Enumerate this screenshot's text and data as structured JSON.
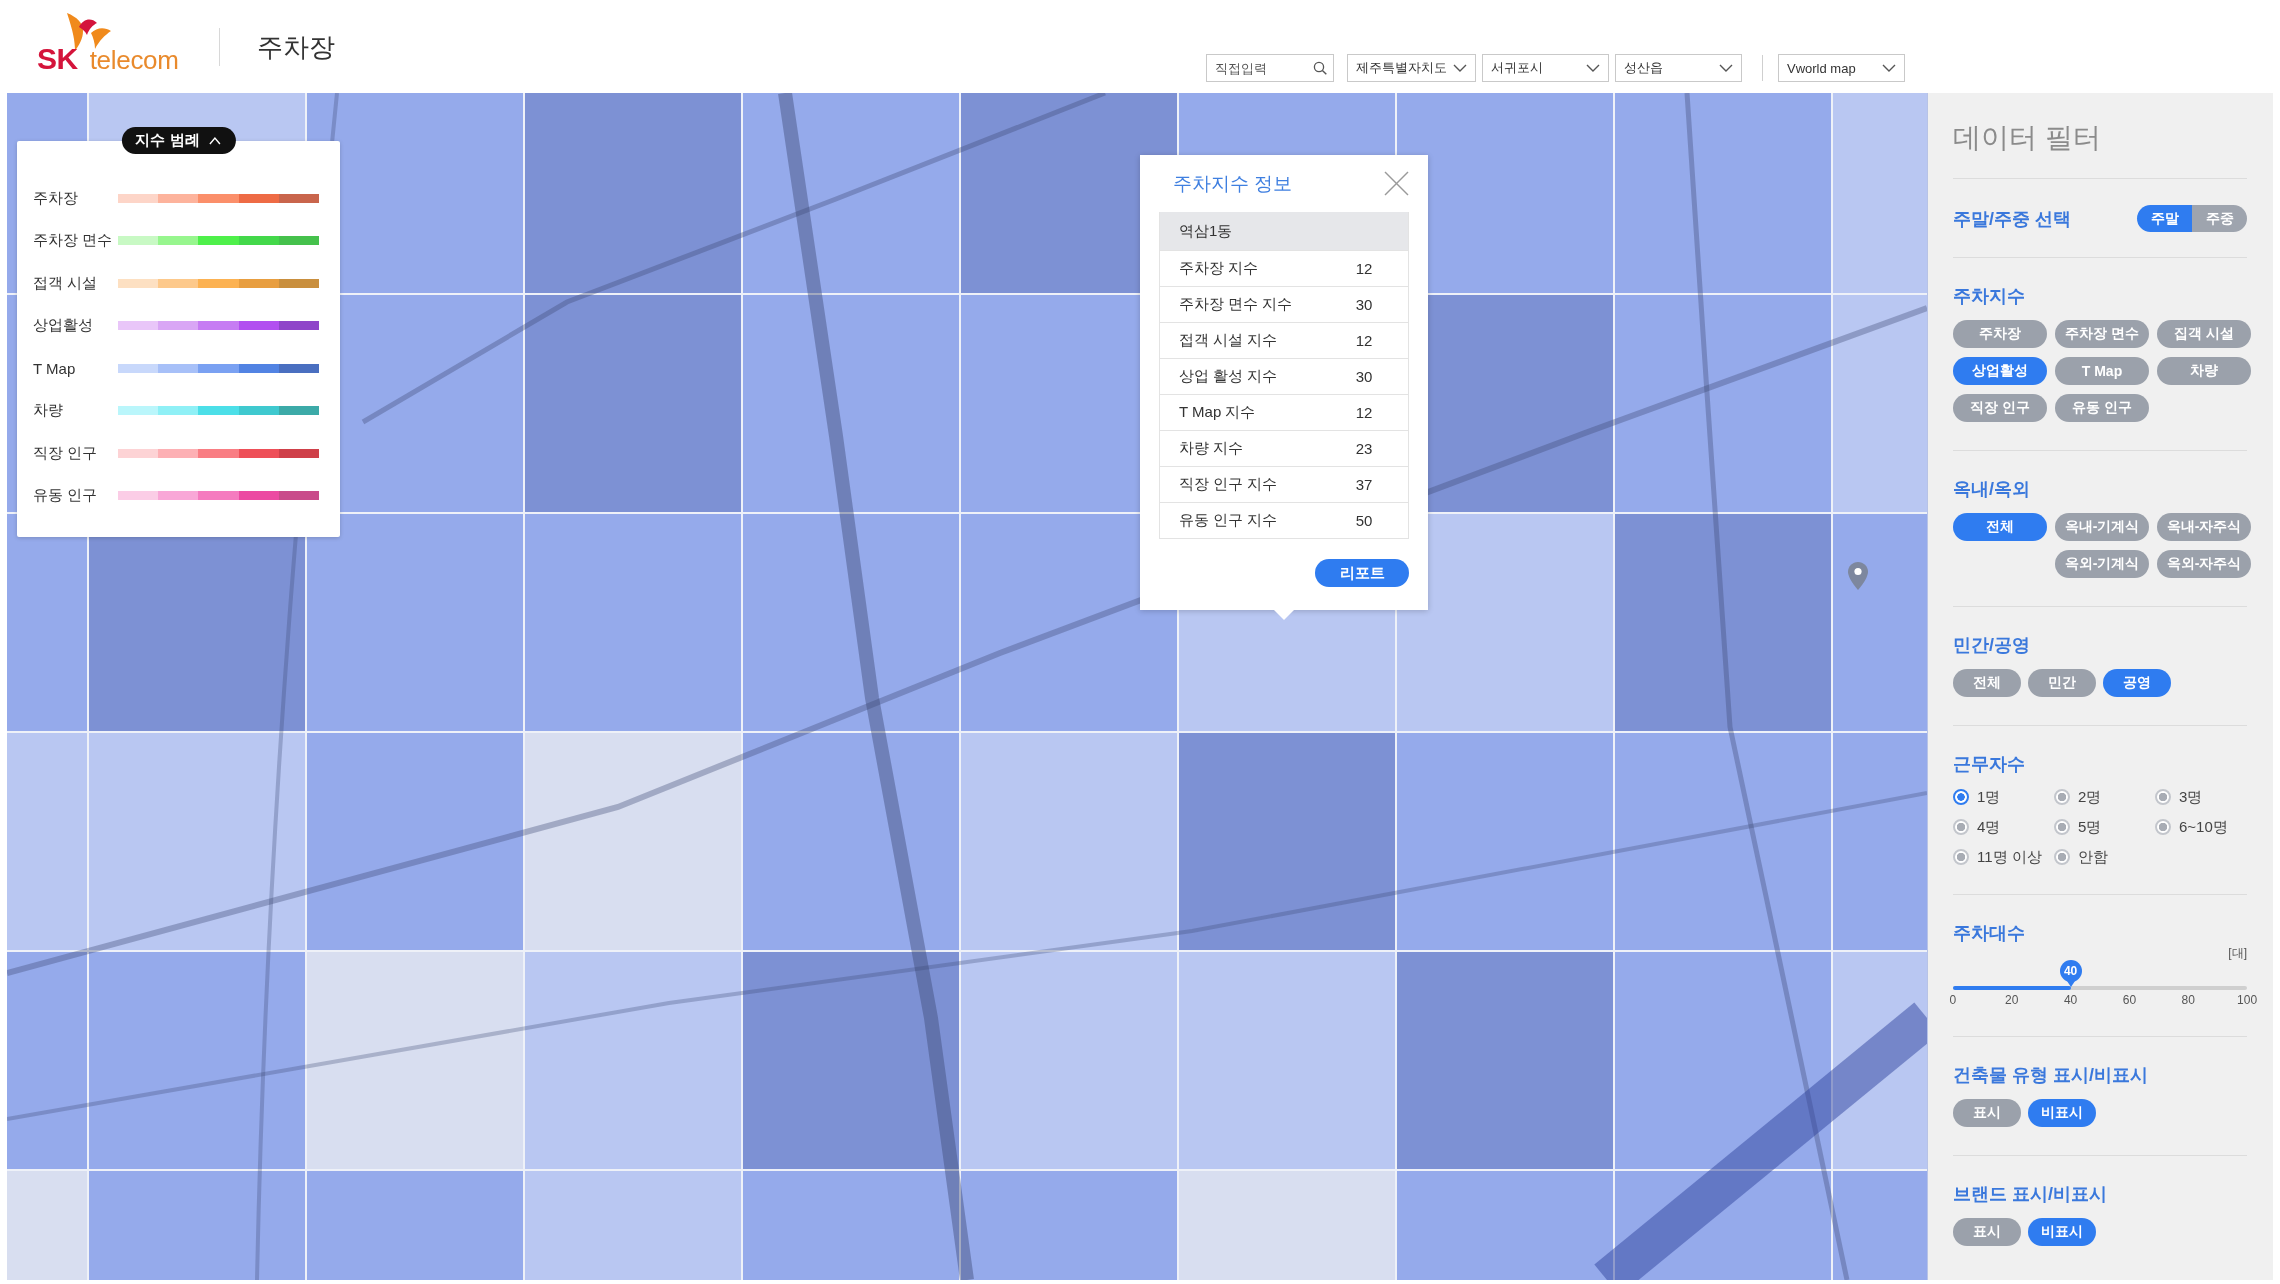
{
  "header": {
    "logo": {
      "mark": "SK",
      "name": "telecom"
    },
    "title": "주차장",
    "search": {
      "placeholder": "직접입력"
    },
    "selects": [
      {
        "value": "제주특별자치도"
      },
      {
        "value": "서귀포시"
      },
      {
        "value": "성산읍"
      }
    ],
    "map_select": {
      "value": "Vworld map"
    }
  },
  "map": {
    "grid": [
      {
        "cells": [
          {
            "color": "#95aaeb"
          },
          {
            "color": "#b9c7f2"
          },
          {
            "color": "#95aaeb"
          },
          {
            "color": "#7d91d4"
          },
          {
            "color": "#95aaeb"
          },
          {
            "color": "#7d91d4"
          },
          {
            "color": "#95aaeb"
          },
          {
            "color": "#95aaeb"
          },
          {
            "color": "#95aaeb"
          },
          {
            "color": "#b9c7f2"
          }
        ]
      },
      {
        "cells": [
          {
            "color": "#95aaeb"
          },
          null,
          {
            "color": "#95aaeb"
          },
          {
            "color": "#7d91d4"
          },
          {
            "color": "#95aaeb"
          },
          {
            "color": "#95aaeb"
          },
          null,
          {
            "color": "#7d91d4"
          },
          {
            "color": "#95aaeb"
          },
          {
            "color": "#b9c7f2"
          }
        ]
      },
      {
        "cells": [
          {
            "color": "#95aaeb"
          },
          {
            "color": "#7d91d4"
          },
          {
            "color": "#95aaeb"
          },
          {
            "color": "#95aaeb"
          },
          {
            "color": "#95aaeb"
          },
          {
            "color": "#95aaeb"
          },
          {
            "color": "#b9c7f2"
          },
          {
            "color": "#b9c7f2"
          },
          {
            "color": "#7d91d4"
          },
          {
            "color": "#95aaeb"
          }
        ]
      },
      {
        "cells": [
          {
            "color": "#b9c7f2"
          },
          {
            "color": "#b9c7f2"
          },
          {
            "color": "#95aaeb"
          },
          {
            "color": "#d8def0"
          },
          {
            "color": "#95aaeb"
          },
          {
            "color": "#b9c7f2"
          },
          {
            "color": "#7d91d4"
          },
          {
            "color": "#95aaeb"
          },
          {
            "color": "#95aaeb"
          },
          {
            "color": "#95aaeb"
          }
        ]
      },
      {
        "cells": [
          {
            "color": "#95aaeb"
          },
          {
            "color": "#95aaeb"
          },
          {
            "color": "#d8def0"
          },
          {
            "color": "#b9c7f2"
          },
          {
            "color": "#7d91d4"
          },
          {
            "color": "#b9c7f2"
          },
          {
            "color": "#b9c7f2"
          },
          {
            "color": "#7d91d4"
          },
          {
            "color": "#95aaeb"
          },
          {
            "color": "#b9c7f2"
          }
        ]
      },
      {
        "cells": [
          {
            "color": "#d8def0"
          },
          {
            "color": "#95aaeb"
          },
          {
            "color": "#95aaeb"
          },
          {
            "color": "#b9c7f2"
          },
          {
            "color": "#95aaeb"
          },
          {
            "color": "#95aaeb"
          },
          {
            "color": "#d8def0"
          },
          {
            "color": "#95aaeb"
          },
          {
            "color": "#95aaeb"
          },
          {
            "color": "#95aaeb"
          }
        ]
      }
    ],
    "legend": {
      "label": "지수 범례",
      "expanded": true,
      "items": [
        {
          "label": "주차장",
          "segments": [
            {
              "color": "#fdd5c8"
            },
            {
              "color": "#fdb39c"
            },
            {
              "color": "#fb8f6a"
            },
            {
              "color": "#ee6b45"
            },
            {
              "color": "#c9654c"
            }
          ]
        },
        {
          "label": "주차장 면수",
          "segments": [
            {
              "color": "#c8f9c4"
            },
            {
              "color": "#97f68e"
            },
            {
              "color": "#4ef04a"
            },
            {
              "color": "#43d84a"
            },
            {
              "color": "#45c14c"
            }
          ]
        },
        {
          "label": "접객 시설",
          "segments": [
            {
              "color": "#fde0c2"
            },
            {
              "color": "#fdc98b"
            },
            {
              "color": "#fcb252"
            },
            {
              "color": "#e89e40"
            },
            {
              "color": "#c98f3e"
            }
          ]
        },
        {
          "label": "상업활성",
          "segments": [
            {
              "color": "#e9c6f9"
            },
            {
              "color": "#d9a6f5"
            },
            {
              "color": "#c67cf3"
            },
            {
              "color": "#b24ff0"
            },
            {
              "color": "#8f45c9"
            }
          ]
        },
        {
          "label": "T Map",
          "segments": [
            {
              "color": "#c8d8fb"
            },
            {
              "color": "#a7c0f8"
            },
            {
              "color": "#7aa1f2"
            },
            {
              "color": "#5283e3"
            },
            {
              "color": "#4a6fc0"
            }
          ]
        },
        {
          "label": "차량",
          "segments": [
            {
              "color": "#baf6fb"
            },
            {
              "color": "#8ff0f6"
            },
            {
              "color": "#4cdfe8"
            },
            {
              "color": "#3fc9cf"
            },
            {
              "color": "#3caaa8"
            }
          ]
        },
        {
          "label": "직장 인구",
          "segments": [
            {
              "color": "#fdd3d5"
            },
            {
              "color": "#fdb0b4"
            },
            {
              "color": "#f97d83"
            },
            {
              "color": "#ee4f58"
            },
            {
              "color": "#cf4049"
            }
          ]
        },
        {
          "label": "유동 인구",
          "segments": [
            {
              "color": "#fbcde6"
            },
            {
              "color": "#f9a7d7"
            },
            {
              "color": "#f57bbf"
            },
            {
              "color": "#ec4aa2"
            },
            {
              "color": "#c94b8a"
            }
          ]
        }
      ]
    },
    "popup": {
      "title": "주차지수 정보",
      "area": "역삼1동",
      "rows": [
        {
          "label": "주차장 지수",
          "value": "12"
        },
        {
          "label": "주차장 면수 지수",
          "value": "30"
        },
        {
          "label": "접객 시설 지수",
          "value": "12"
        },
        {
          "label": "상업 활성 지수",
          "value": "30"
        },
        {
          "label": "T Map 지수",
          "value": "12"
        },
        {
          "label": "차량 지수",
          "value": "23"
        },
        {
          "label": "직장 인구 지수",
          "value": "37"
        },
        {
          "label": "유동 인구 지수",
          "value": "50"
        }
      ],
      "button": "리포트"
    }
  },
  "filters": {
    "title": "데이터 필터",
    "sections": [
      {
        "kind": "toggle",
        "title": "주말/주중 선택",
        "options": [
          {
            "label": "주말",
            "selected": true
          },
          {
            "label": "주중",
            "selected": false
          }
        ]
      },
      {
        "kind": "chips",
        "title": "주차지수",
        "options": [
          {
            "label": "주차장",
            "selected": false
          },
          {
            "label": "주차장 면수",
            "selected": false
          },
          {
            "label": "집객 시설",
            "selected": false
          },
          {
            "label": "상업활성",
            "selected": true
          },
          {
            "label": "T Map",
            "selected": false
          },
          {
            "label": "차량",
            "selected": false
          },
          {
            "label": "직장 인구",
            "selected": false
          },
          {
            "label": "유동 인구",
            "selected": false
          }
        ]
      },
      {
        "kind": "split",
        "title": "옥내/옥외",
        "options": [
          {
            "label": "전체",
            "selected": true
          },
          {
            "label": "옥내-기계식",
            "selected": false
          },
          {
            "label": "옥내-자주식",
            "selected": false
          },
          {
            "label": "옥외-기계식",
            "selected": false
          },
          {
            "label": "옥외-자주식",
            "selected": false
          }
        ]
      },
      {
        "kind": "pills",
        "title": "민간/공영",
        "options": [
          {
            "label": "전체",
            "selected": false
          },
          {
            "label": "민간",
            "selected": false
          },
          {
            "label": "공영",
            "selected": true
          }
        ]
      },
      {
        "kind": "radios",
        "title": "근무자수",
        "options": [
          {
            "label": "1명",
            "selected": true
          },
          {
            "label": "2명",
            "selected": false
          },
          {
            "label": "3명",
            "selected": false
          },
          {
            "label": "4명",
            "selected": false
          },
          {
            "label": "5명",
            "selected": false
          },
          {
            "label": "6~10명",
            "selected": false
          },
          {
            "label": "11명 이상",
            "selected": false
          },
          {
            "label": "안함",
            "selected": false
          }
        ]
      },
      {
        "kind": "slider",
        "title": "주차대수",
        "unit": "[대]",
        "value": "40",
        "level": 0.4,
        "ticks": [
          "0",
          "20",
          "40",
          "60",
          "80",
          "100"
        ]
      },
      {
        "kind": "pills",
        "title": "건축물 유형 표시/비표시",
        "options": [
          {
            "label": "표시",
            "selected": false
          },
          {
            "label": "비표시",
            "selected": true
          }
        ]
      },
      {
        "kind": "pills",
        "title": "브랜드 표시/비표시",
        "options": [
          {
            "label": "표시",
            "selected": false
          },
          {
            "label": "비표시",
            "selected": true
          }
        ]
      }
    ]
  }
}
